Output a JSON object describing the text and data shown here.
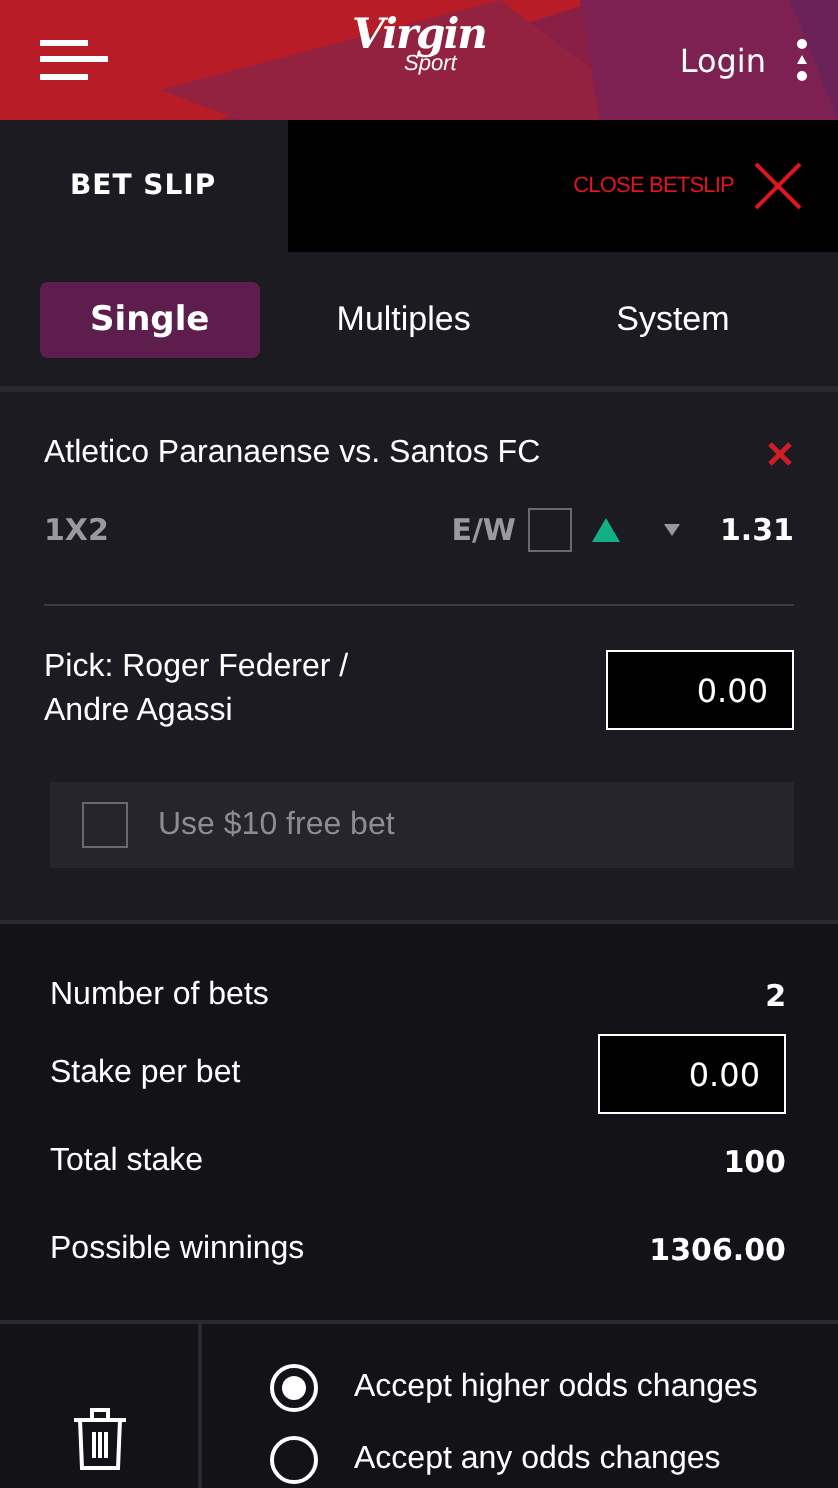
{
  "header": {
    "logo": {
      "main": "Virgin",
      "sub": "Sport"
    },
    "login": "Login"
  },
  "betslip_bar": {
    "title": "BET SLIP",
    "close_label": "CLOSE BETSLIP"
  },
  "tabs": [
    {
      "label": "Single",
      "selected": true
    },
    {
      "label": "Multiples",
      "selected": false
    },
    {
      "label": "System",
      "selected": false
    }
  ],
  "bet": {
    "event": "Atletico Paranaense vs. Santos FC",
    "market": "1X2",
    "ew_label": "E/W",
    "ew_checked": false,
    "odds": "1.31",
    "pick": "Pick: Roger Federer / Andre Agassi",
    "stake": "0.00",
    "free_bet": {
      "label": "Use $10 free bet",
      "checked": false
    }
  },
  "summary": [
    {
      "kind": "text",
      "label": "Number of bets",
      "value": "2"
    },
    {
      "kind": "input",
      "label": "Stake per bet",
      "value": "0.00"
    },
    {
      "kind": "text",
      "label": "Total stake",
      "value": "100"
    },
    {
      "kind": "text",
      "label": "Possible winnings",
      "value": "1306.00"
    }
  ],
  "odds_options": [
    {
      "label": "Accept higher odds changes",
      "selected": true
    },
    {
      "label": "Accept any odds changes",
      "selected": false
    }
  ]
}
